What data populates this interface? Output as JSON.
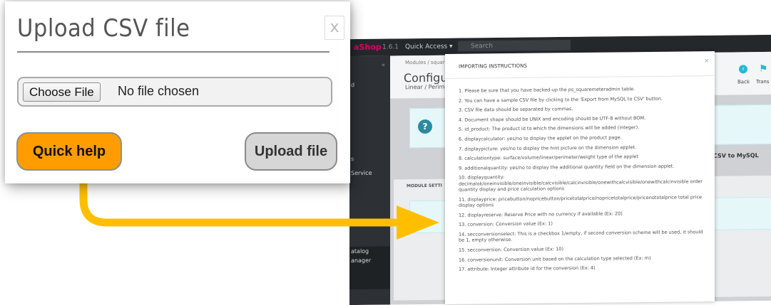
{
  "upload_dialog": {
    "title": "Upload CSV file",
    "close_label": "x",
    "choose_file_label": "Choose File",
    "no_file_text": "No file chosen",
    "quick_help_label": "Quick help",
    "upload_label": "Upload file"
  },
  "instructions_modal": {
    "title": "IMPORTING INSTRUCTIONS",
    "close_label": "×",
    "items": [
      "1. Please be sure that you have backed-up the ps_squaremeteradmin table.",
      "2. You can have a sample CSV file by clicking to the 'Export from MySQL to CSV' button.",
      "3. CSV file data should be separated by commas.",
      "4. Document shape should be UNIX and encoding should be UTF-8 without BOM.",
      "5. id_product: The product id to which the dimensions will be added (integer).",
      "6. displaycalculator: yes/no to display the applet on the product page.",
      "7. displaypicture: yes/no to display the hint picture on the dimension applet.",
      "8. calculationtype: surface/volume/linear/perimeter/weight type of the applet",
      "9. additionalquantity: yes/no to display the additional quantity field on the dimension applet.",
      "10. displayquantity:\ndecimalok/oneinvisible/oneinvisible/calcvisible/calcinvisible/onewithcalcvisible/onewithcalcinvisible order quantity display and price calculation options",
      "11. displayprice: pricebutton/nopricebutton/pricetotalprice/nopricetotalprice/pricenototalprice total price display options",
      "12. displayreserve: Reserve Price with no currency if available (Ex: 20)",
      "13. conversion: Conversion value (Ex: 1)",
      "14. secconversionselect: This is a checkbox 1/empty, if second conversion scheme will be used, it should be 1, empty otherwise.",
      "15. secconversion: Conversion value (Ex: 10)",
      "16. conversionunit: Conversion unit based on the calculation type selected (Ex: m)",
      "17. attribute: Integer attribute id for the conversion (Ex: 4)"
    ]
  },
  "background": {
    "logo": "aShop",
    "version": "1.6.1",
    "quick_access": "Quick Access ▾",
    "search_placeholder": "Search",
    "breadcrumb": "Modules / square",
    "config_title": "Configur",
    "config_subtitle": "Linear / Perime",
    "back_label": "Back",
    "trans_label": "Trans",
    "csv_button": "CSV to MySQL",
    "module_settings": "MODULE SETTI",
    "sidebar_items": [
      "d",
      "s",
      "Service",
      "atalog",
      "anager"
    ]
  },
  "colors": {
    "quick_help_bg": "#ff9d00",
    "arrow": "#ffbf00",
    "upload_bg": "#d6d6d6"
  }
}
